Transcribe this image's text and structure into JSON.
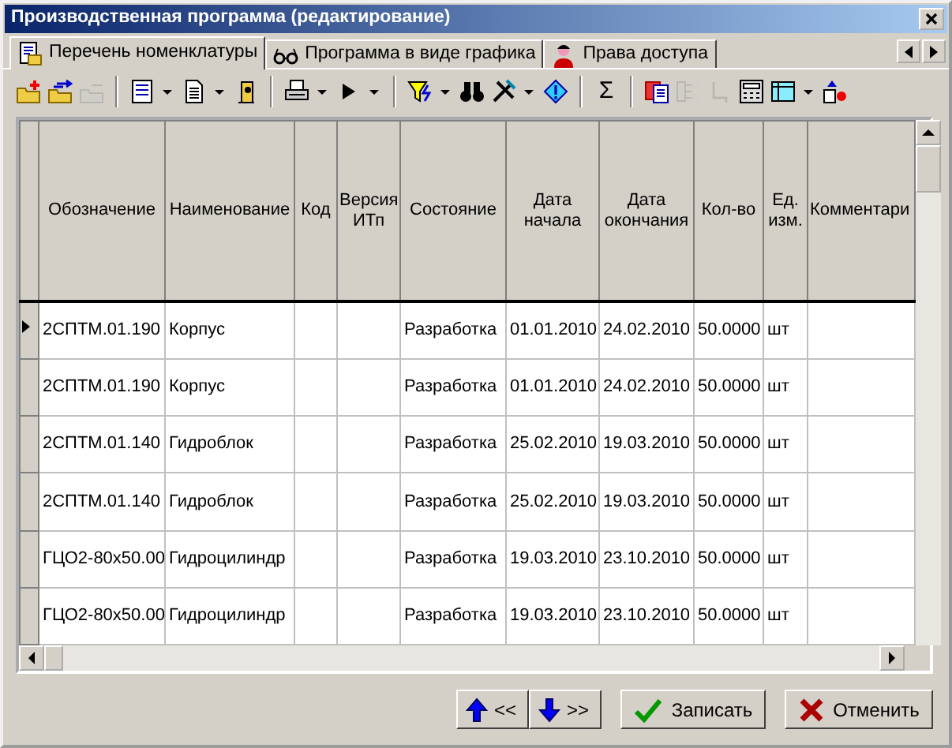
{
  "window": {
    "title": "Производственная программа (редактирование)"
  },
  "tabs": [
    {
      "label": "Перечень номенклатуры",
      "selected": true
    },
    {
      "label": "Программа в виде графика",
      "selected": false
    },
    {
      "label": "Права доступа",
      "selected": false
    }
  ],
  "toolbar": [
    [
      {
        "disabled": false
      },
      {
        "disabled": false
      },
      {
        "disabled": true
      }
    ],
    [
      {
        "dropdown": true,
        "disabled": false
      },
      {
        "dropdown": true,
        "disabled": false
      },
      {
        "disabled": false
      }
    ],
    [
      {
        "dropdown": true,
        "disabled": false
      },
      {
        "dropdown": true,
        "disabled": false
      }
    ],
    [
      {
        "dropdown": true,
        "disabled": false
      },
      {
        "disabled": false
      },
      {
        "dropdown": true,
        "disabled": false
      },
      {
        "disabled": false
      }
    ],
    [
      {
        "disabled": false,
        "label": "Σ"
      }
    ],
    [
      {
        "disabled": false
      },
      {
        "disabled": true
      },
      {
        "disabled": true
      },
      {
        "disabled": false
      },
      {
        "dropdown": true,
        "disabled": false
      },
      {
        "disabled": false
      }
    ]
  ],
  "table": {
    "columns": [
      "Обозначение",
      "Наименование",
      "Код",
      "Версия ИТп",
      "Состояние",
      "Дата начала",
      "Дата окончания",
      "Кол-во",
      "Ед. изм.",
      "Комментари"
    ],
    "rows": [
      {
        "selected": true,
        "cells": [
          "2СПТМ.01.190",
          "Корпус",
          "",
          "",
          "Разработка",
          "01.01.2010",
          "24.02.2010",
          "50.0000",
          "шт",
          ""
        ]
      },
      {
        "selected": false,
        "cells": [
          "2СПТМ.01.190",
          "Корпус",
          "",
          "",
          "Разработка",
          "01.01.2010",
          "24.02.2010",
          "50.0000",
          "шт",
          ""
        ]
      },
      {
        "selected": false,
        "cells": [
          "2СПТМ.01.140",
          "Гидроблок",
          "",
          "",
          "Разработка",
          "25.02.2010",
          "19.03.2010",
          "50.0000",
          "шт",
          ""
        ]
      },
      {
        "selected": false,
        "cells": [
          "2СПТМ.01.140",
          "Гидроблок",
          "",
          "",
          "Разработка",
          "25.02.2010",
          "19.03.2010",
          "50.0000",
          "шт",
          ""
        ]
      },
      {
        "selected": false,
        "cells": [
          "ГЦО2-80x50.00",
          "Гидроцилиндр",
          "",
          "",
          "Разработка",
          "19.03.2010",
          "23.10.2010",
          "50.0000",
          "шт",
          ""
        ]
      },
      {
        "selected": false,
        "cells": [
          "ГЦО2-80x50.00",
          "Гидроцилиндр",
          "",
          "",
          "Разработка",
          "19.03.2010",
          "23.10.2010",
          "50.0000",
          "шт",
          ""
        ]
      }
    ]
  },
  "buttons": [
    {
      "kind": "up",
      "label": "<<"
    },
    {
      "kind": "down",
      "label": ">>"
    },
    {
      "kind": "save",
      "label": "Записать"
    },
    {
      "kind": "cancel",
      "label": "Отменить"
    }
  ]
}
